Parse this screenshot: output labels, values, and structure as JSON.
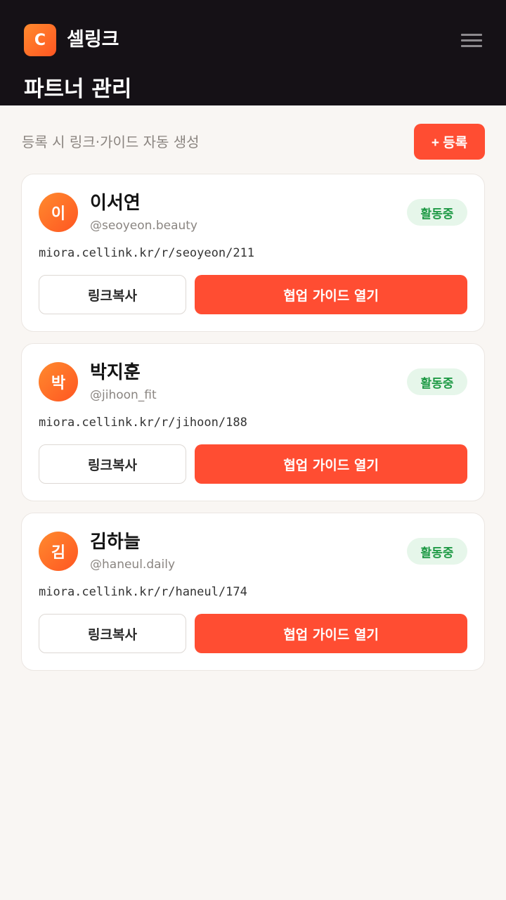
{
  "header": {
    "logo_letter": "C",
    "brand": "셀링크",
    "menu_icon": "hamburger-menu-icon",
    "page_title": "파트너 관리"
  },
  "toolbar": {
    "hint": "등록 시 링크·가이드 자동 생성",
    "register_label": "+ 등록"
  },
  "colors": {
    "header_bg": "#151116",
    "accent": "#ff4d32",
    "status_bg": "#e6f6ea",
    "status_text": "#1f9a46",
    "page_bg": "#f9f6f3"
  },
  "partners": [
    {
      "initial": "이",
      "name": "이서연",
      "handle": "@seoyeon.beauty",
      "status": "활동중",
      "link": "miora.cellink.kr/r/seoyeon/211",
      "copy_label": "링크복사",
      "guide_label": "협업 가이드 열기"
    },
    {
      "initial": "박",
      "name": "박지훈",
      "handle": "@jihoon_fit",
      "status": "활동중",
      "link": "miora.cellink.kr/r/jihoon/188",
      "copy_label": "링크복사",
      "guide_label": "협업 가이드 열기"
    },
    {
      "initial": "김",
      "name": "김하늘",
      "handle": "@haneul.daily",
      "status": "활동중",
      "link": "miora.cellink.kr/r/haneul/174",
      "copy_label": "링크복사",
      "guide_label": "협업 가이드 열기"
    }
  ]
}
